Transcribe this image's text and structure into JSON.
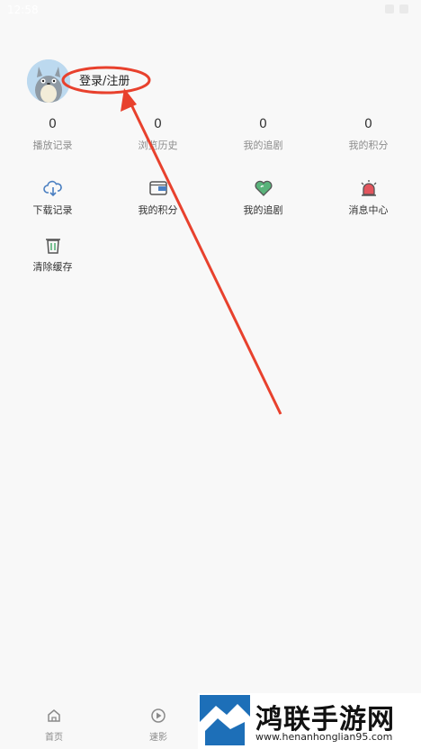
{
  "status_bar": {
    "time": "12:58"
  },
  "profile": {
    "login_label": "登录/注册"
  },
  "stats": [
    {
      "value": "0",
      "label": "播放记录"
    },
    {
      "value": "0",
      "label": "浏览历史"
    },
    {
      "value": "0",
      "label": "我的追剧"
    },
    {
      "value": "0",
      "label": "我的积分"
    }
  ],
  "grid": [
    {
      "label": "下载记录",
      "icon": "cloud-download-icon"
    },
    {
      "label": "我的积分",
      "icon": "wallet-icon"
    },
    {
      "label": "我的追剧",
      "icon": "heart-icon"
    },
    {
      "label": "消息中心",
      "icon": "alarm-icon"
    },
    {
      "label": "清除缓存",
      "icon": "trash-icon"
    }
  ],
  "tabbar": [
    {
      "label": "首页",
      "icon": "home-icon"
    },
    {
      "label": "速影",
      "icon": "play-circle-icon"
    }
  ],
  "watermark": {
    "title": "鸿联手游网",
    "url": "www.henanhonglian95.com"
  },
  "colors": {
    "annotation": "#e8412d",
    "background": "#f8f8f8",
    "icon_blue": "#4a7fc1",
    "icon_green": "#59b37a",
    "icon_red": "#e2555d"
  }
}
